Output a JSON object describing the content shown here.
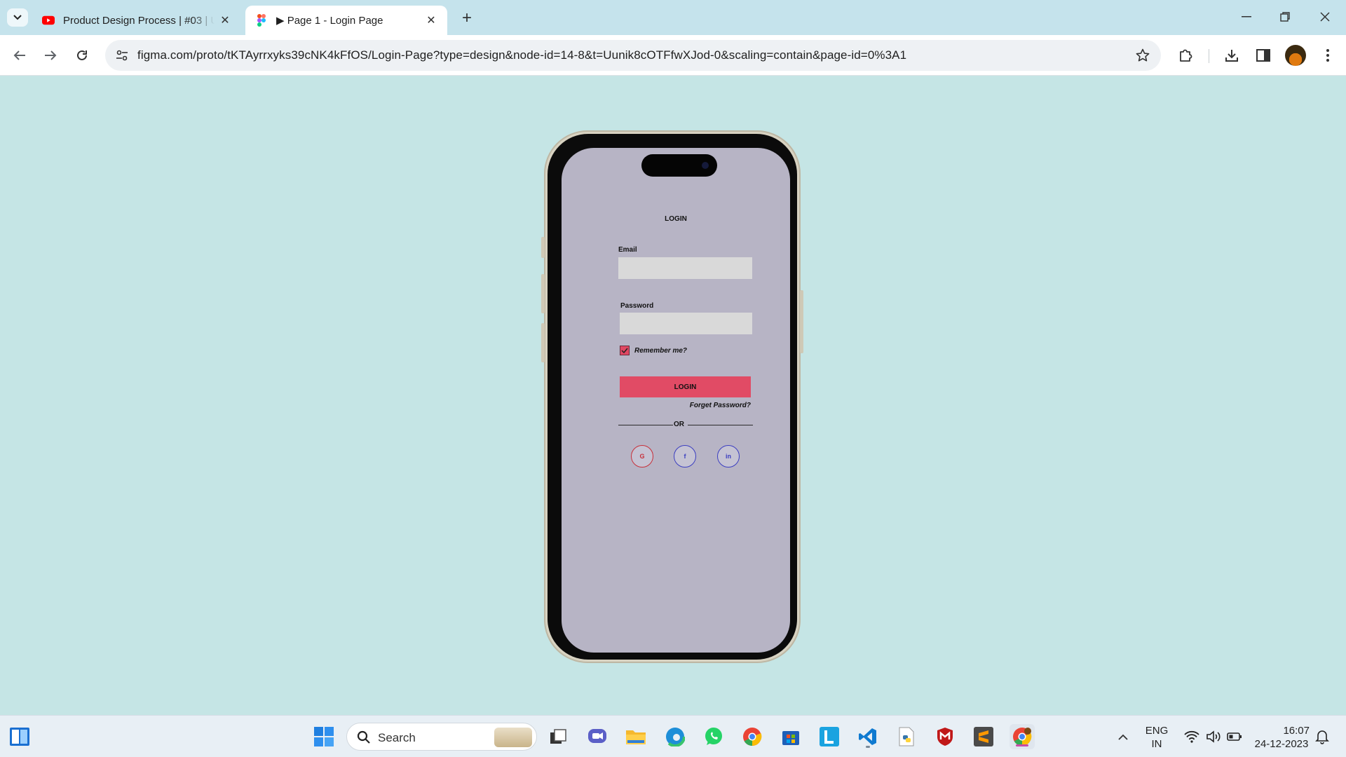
{
  "browser": {
    "tabs": [
      {
        "title": "Product Design Process | #03 | UI",
        "active": false,
        "favicon": "youtube-icon"
      },
      {
        "title": "▶ Page 1 - Login Page",
        "active": true,
        "favicon": "figma-icon"
      }
    ],
    "url": "figma.com/proto/tKTAyrrxyks39cNK4kFfOS/Login-Page?type=design&node-id=14-8&t=Uunik8cOTFfwXJod-0&scaling=contain&page-id=0%3A1"
  },
  "login_screen": {
    "heading": "LOGIN",
    "email_label": "Email",
    "email_value": "",
    "password_label": "Password",
    "password_value": "",
    "remember_label": "Remember me?",
    "remember_checked": true,
    "login_button": "LOGIN",
    "forget_password": "Forget Password?",
    "divider_text": "OR",
    "social": [
      {
        "label": "G",
        "color": "#c8303a"
      },
      {
        "label": "f",
        "color": "#3b3ec0"
      },
      {
        "label": "in",
        "color": "#3b3ec0"
      }
    ],
    "accent_color": "#e14b65",
    "screen_color": "#b7b4c5"
  },
  "taskbar": {
    "search_label": "Search",
    "language": "ENG",
    "region": "IN",
    "time": "16:07",
    "date": "24-12-2023"
  }
}
